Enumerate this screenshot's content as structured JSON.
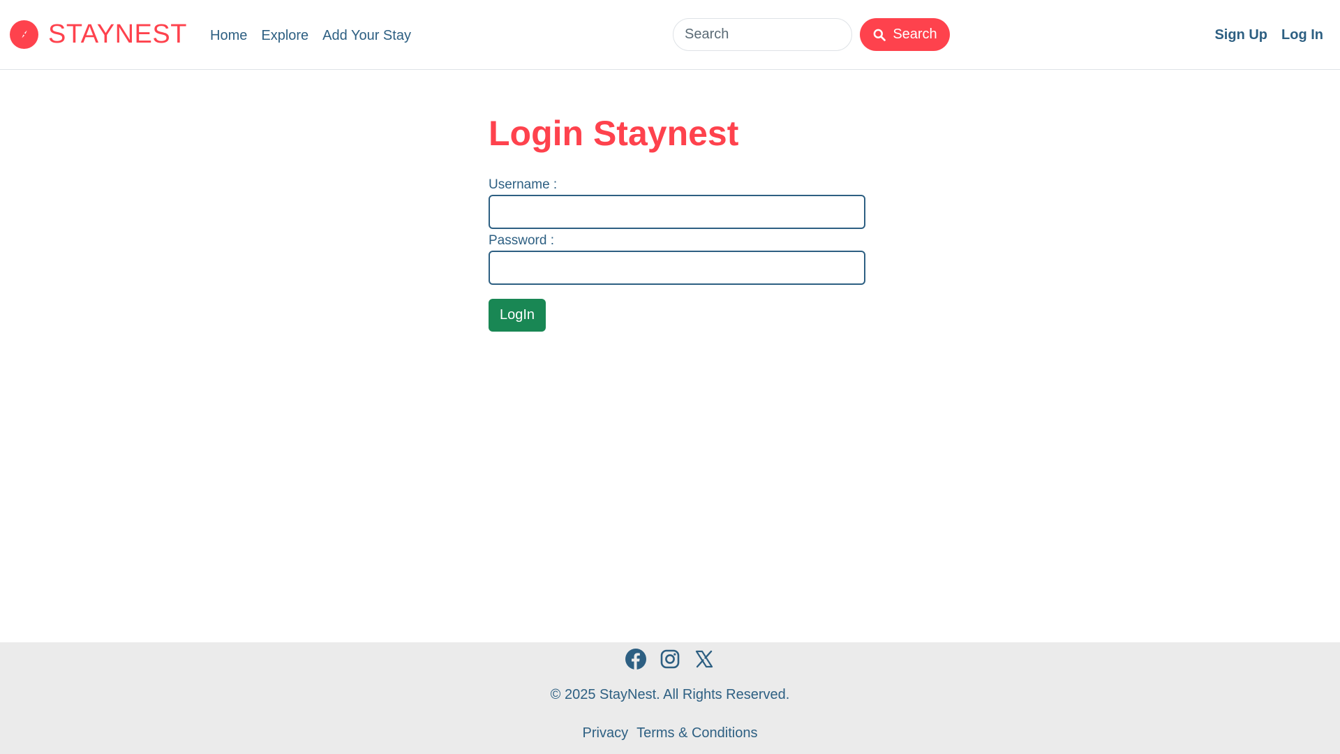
{
  "brand": {
    "name": "STAYNEST",
    "icon": "compass-icon",
    "color": "#fe424d"
  },
  "nav": {
    "links": [
      "Home",
      "Explore",
      "Add Your Stay"
    ]
  },
  "search": {
    "placeholder": "Search",
    "button_label": "Search",
    "button_icon": "magnifier-icon"
  },
  "auth": {
    "signup_label": "Sign Up",
    "login_label": "Log In"
  },
  "main": {
    "title": "Login Staynest",
    "username_label": "Username :",
    "username_value": "",
    "password_label": "Password :",
    "password_value": "",
    "submit_label": "LogIn"
  },
  "footer": {
    "social_icons": [
      "facebook-icon",
      "instagram-icon",
      "x-icon"
    ],
    "copyright": "© 2025 StayNest. All Rights Reserved.",
    "links": [
      "Privacy",
      "Terms & Conditions"
    ]
  },
  "colors": {
    "accent": "#fe424d",
    "text": "#2d5f82",
    "success": "#198754",
    "footer_bg": "#ebebeb"
  }
}
